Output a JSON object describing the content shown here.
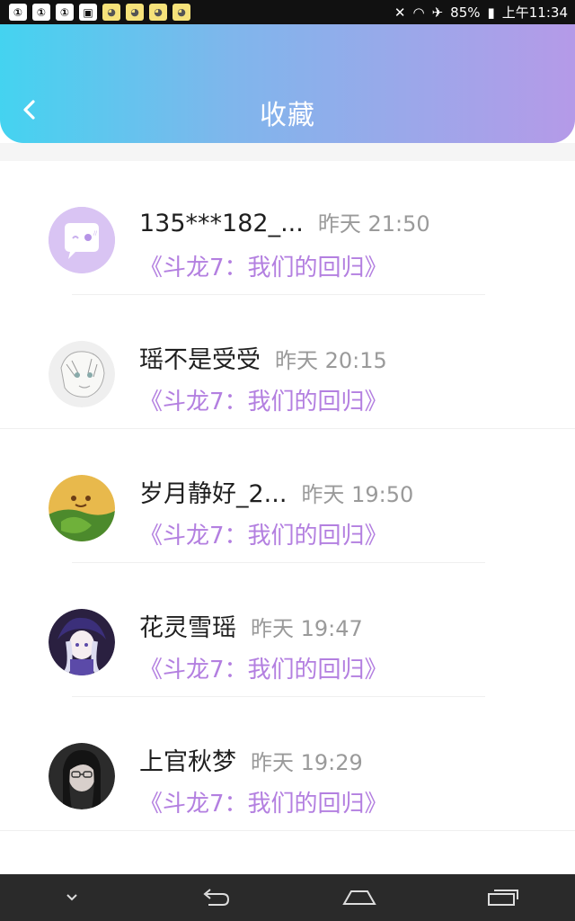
{
  "status_bar": {
    "left_icons": [
      "notification-icon",
      "notification-icon",
      "notification-icon",
      "image-icon",
      "chat-icon",
      "chat-icon",
      "chat-icon",
      "chat-icon"
    ],
    "battery": "85%",
    "time": "上午11:34"
  },
  "header": {
    "title": "收藏"
  },
  "items": [
    {
      "name": "135***182_...",
      "time": "昨天 21:50",
      "book": "《斗龙7：我们的回归》",
      "avatar": "default-chat-avatar"
    },
    {
      "name": "瑶不是受受",
      "time": "昨天 20:15",
      "book": "《斗龙7：我们的回归》",
      "avatar": "sketch-avatar"
    },
    {
      "name": "岁月静好_2...",
      "time": "昨天 19:50",
      "book": "《斗龙7：我们的回归》",
      "avatar": "cartoon-avatar"
    },
    {
      "name": "花灵雪瑶",
      "time": "昨天 19:47",
      "book": "《斗龙7：我们的回归》",
      "avatar": "anime-avatar"
    },
    {
      "name": "上官秋梦",
      "time": "昨天 19:29",
      "book": "《斗龙7：我们的回归》",
      "avatar": "photo-avatar"
    }
  ],
  "colors": {
    "header_start": "#44d3f0",
    "header_end": "#b59ae8",
    "book_title": "#b37fe0"
  }
}
